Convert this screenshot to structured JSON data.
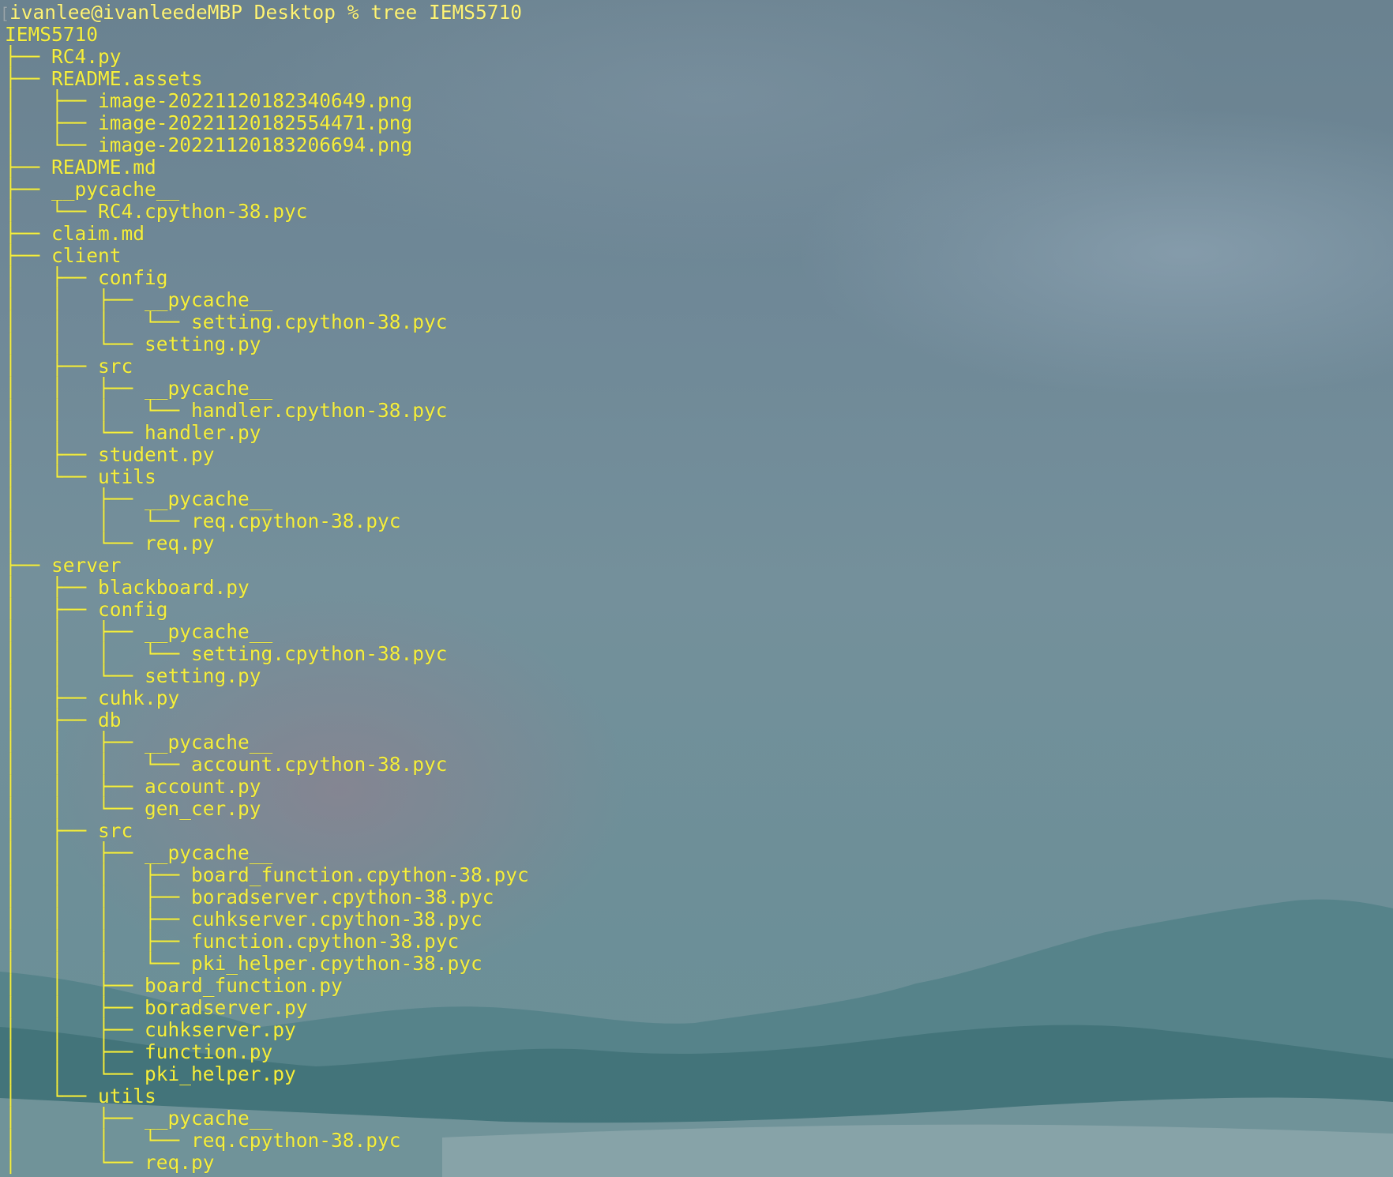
{
  "terminal": {
    "prompt": "ivanlee@ivanleedeMBP Desktop % tree IEMS5710",
    "prompt_marker": "[",
    "lines": [
      "IEMS5710",
      "├── RC4.py",
      "├── README.assets",
      "│   ├── image-20221120182340649.png",
      "│   ├── image-20221120182554471.png",
      "│   └── image-20221120183206694.png",
      "├── README.md",
      "├── __pycache__",
      "│   └── RC4.cpython-38.pyc",
      "├── claim.md",
      "├── client",
      "│   ├── config",
      "│   │   ├── __pycache__",
      "│   │   │   └── setting.cpython-38.pyc",
      "│   │   └── setting.py",
      "│   ├── src",
      "│   │   ├── __pycache__",
      "│   │   │   └── handler.cpython-38.pyc",
      "│   │   └── handler.py",
      "│   ├── student.py",
      "│   └── utils",
      "│       ├── __pycache__",
      "│       │   └── req.cpython-38.pyc",
      "│       └── req.py",
      "├── server",
      "│   ├── blackboard.py",
      "│   ├── config",
      "│   │   ├── __pycache__",
      "│   │   │   └── setting.cpython-38.pyc",
      "│   │   └── setting.py",
      "│   ├── cuhk.py",
      "│   ├── db",
      "│   │   ├── __pycache__",
      "│   │   │   └── account.cpython-38.pyc",
      "│   │   ├── account.py",
      "│   │   └── gen_cer.py",
      "│   ├── src",
      "│   │   ├── __pycache__",
      "│   │   │   ├── board_function.cpython-38.pyc",
      "│   │   │   ├── boradserver.cpython-38.pyc",
      "│   │   │   ├── cuhkserver.cpython-38.pyc",
      "│   │   │   ├── function.cpython-38.pyc",
      "│   │   │   └── pki_helper.cpython-38.pyc",
      "│   │   ├── board_function.py",
      "│   │   ├── boradserver.py",
      "│   │   ├── cuhkserver.py",
      "│   │   ├── function.py",
      "│   │   └── pki_helper.py",
      "│   └── utils",
      "│       ├── __pycache__",
      "│       │   └── req.cpython-38.pyc",
      "│       └── req.py"
    ],
    "colors": {
      "text": "#f6ef3c",
      "background": "#6f8897"
    }
  }
}
